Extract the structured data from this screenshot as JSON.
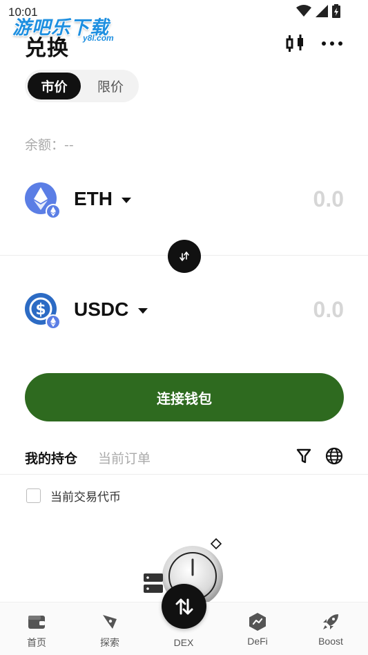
{
  "status_bar": {
    "time": "10:01"
  },
  "watermark": {
    "main": "游吧乐下载",
    "sub": "y8l.com"
  },
  "header": {
    "title": "兑换"
  },
  "order_type": {
    "tabs": [
      "市价",
      "限价"
    ],
    "selected": "市价"
  },
  "balance": {
    "label": "余额：--"
  },
  "swap": {
    "from": {
      "symbol": "ETH",
      "amount": "0.0",
      "icon": "eth-icon"
    },
    "to": {
      "symbol": "USDC",
      "amount": "0.0",
      "icon": "usdc-icon"
    }
  },
  "connect_wallet": {
    "label": "连接钱包"
  },
  "positions": {
    "tabs": [
      "我的持仓",
      "当前订单"
    ],
    "checkbox_label": "当前交易代币"
  },
  "nav": {
    "items": [
      {
        "label": "首页",
        "icon": "wallet-icon"
      },
      {
        "label": "探索",
        "icon": "compass-icon"
      },
      {
        "label": "DEX",
        "icon": "swap-vertical-icon"
      },
      {
        "label": "DeFi",
        "icon": "defi-icon"
      },
      {
        "label": "Boost",
        "icon": "rocket-icon"
      }
    ]
  },
  "colors": {
    "accent": "#2e6a1f",
    "primary_text": "#111111",
    "muted_text": "#aaaaaa",
    "watermark": "#1e8fe0"
  }
}
